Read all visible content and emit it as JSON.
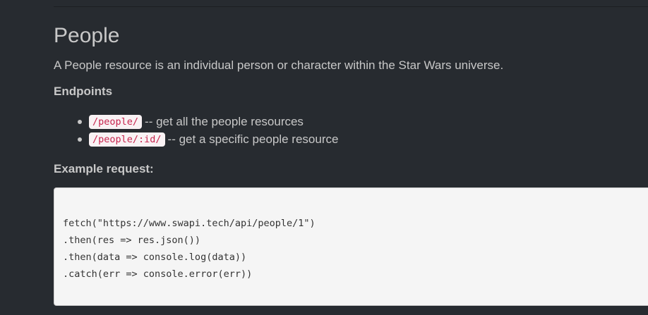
{
  "title": "People",
  "description": "A People resource is an individual person or character within the Star Wars universe.",
  "endpoints": {
    "heading": "Endpoints",
    "items": [
      {
        "path": "/people/",
        "text": "-- get all the people resources"
      },
      {
        "path": "/people/:id/",
        "text": "-- get a specific people resource"
      }
    ]
  },
  "example": {
    "heading": "Example request:",
    "code_lines": [
      "fetch(\"https://www.swapi.tech/api/people/1\")",
      ".then(res => res.json())",
      ".then(data => console.log(data))",
      ".catch(err => console.error(err))"
    ]
  },
  "colors": {
    "background": "#272b30",
    "text": "#c8c8c8",
    "inline_code": "#c7254e",
    "inline_code_bg": "#f9f2f4",
    "code_block_bg": "#f5f5f5"
  }
}
